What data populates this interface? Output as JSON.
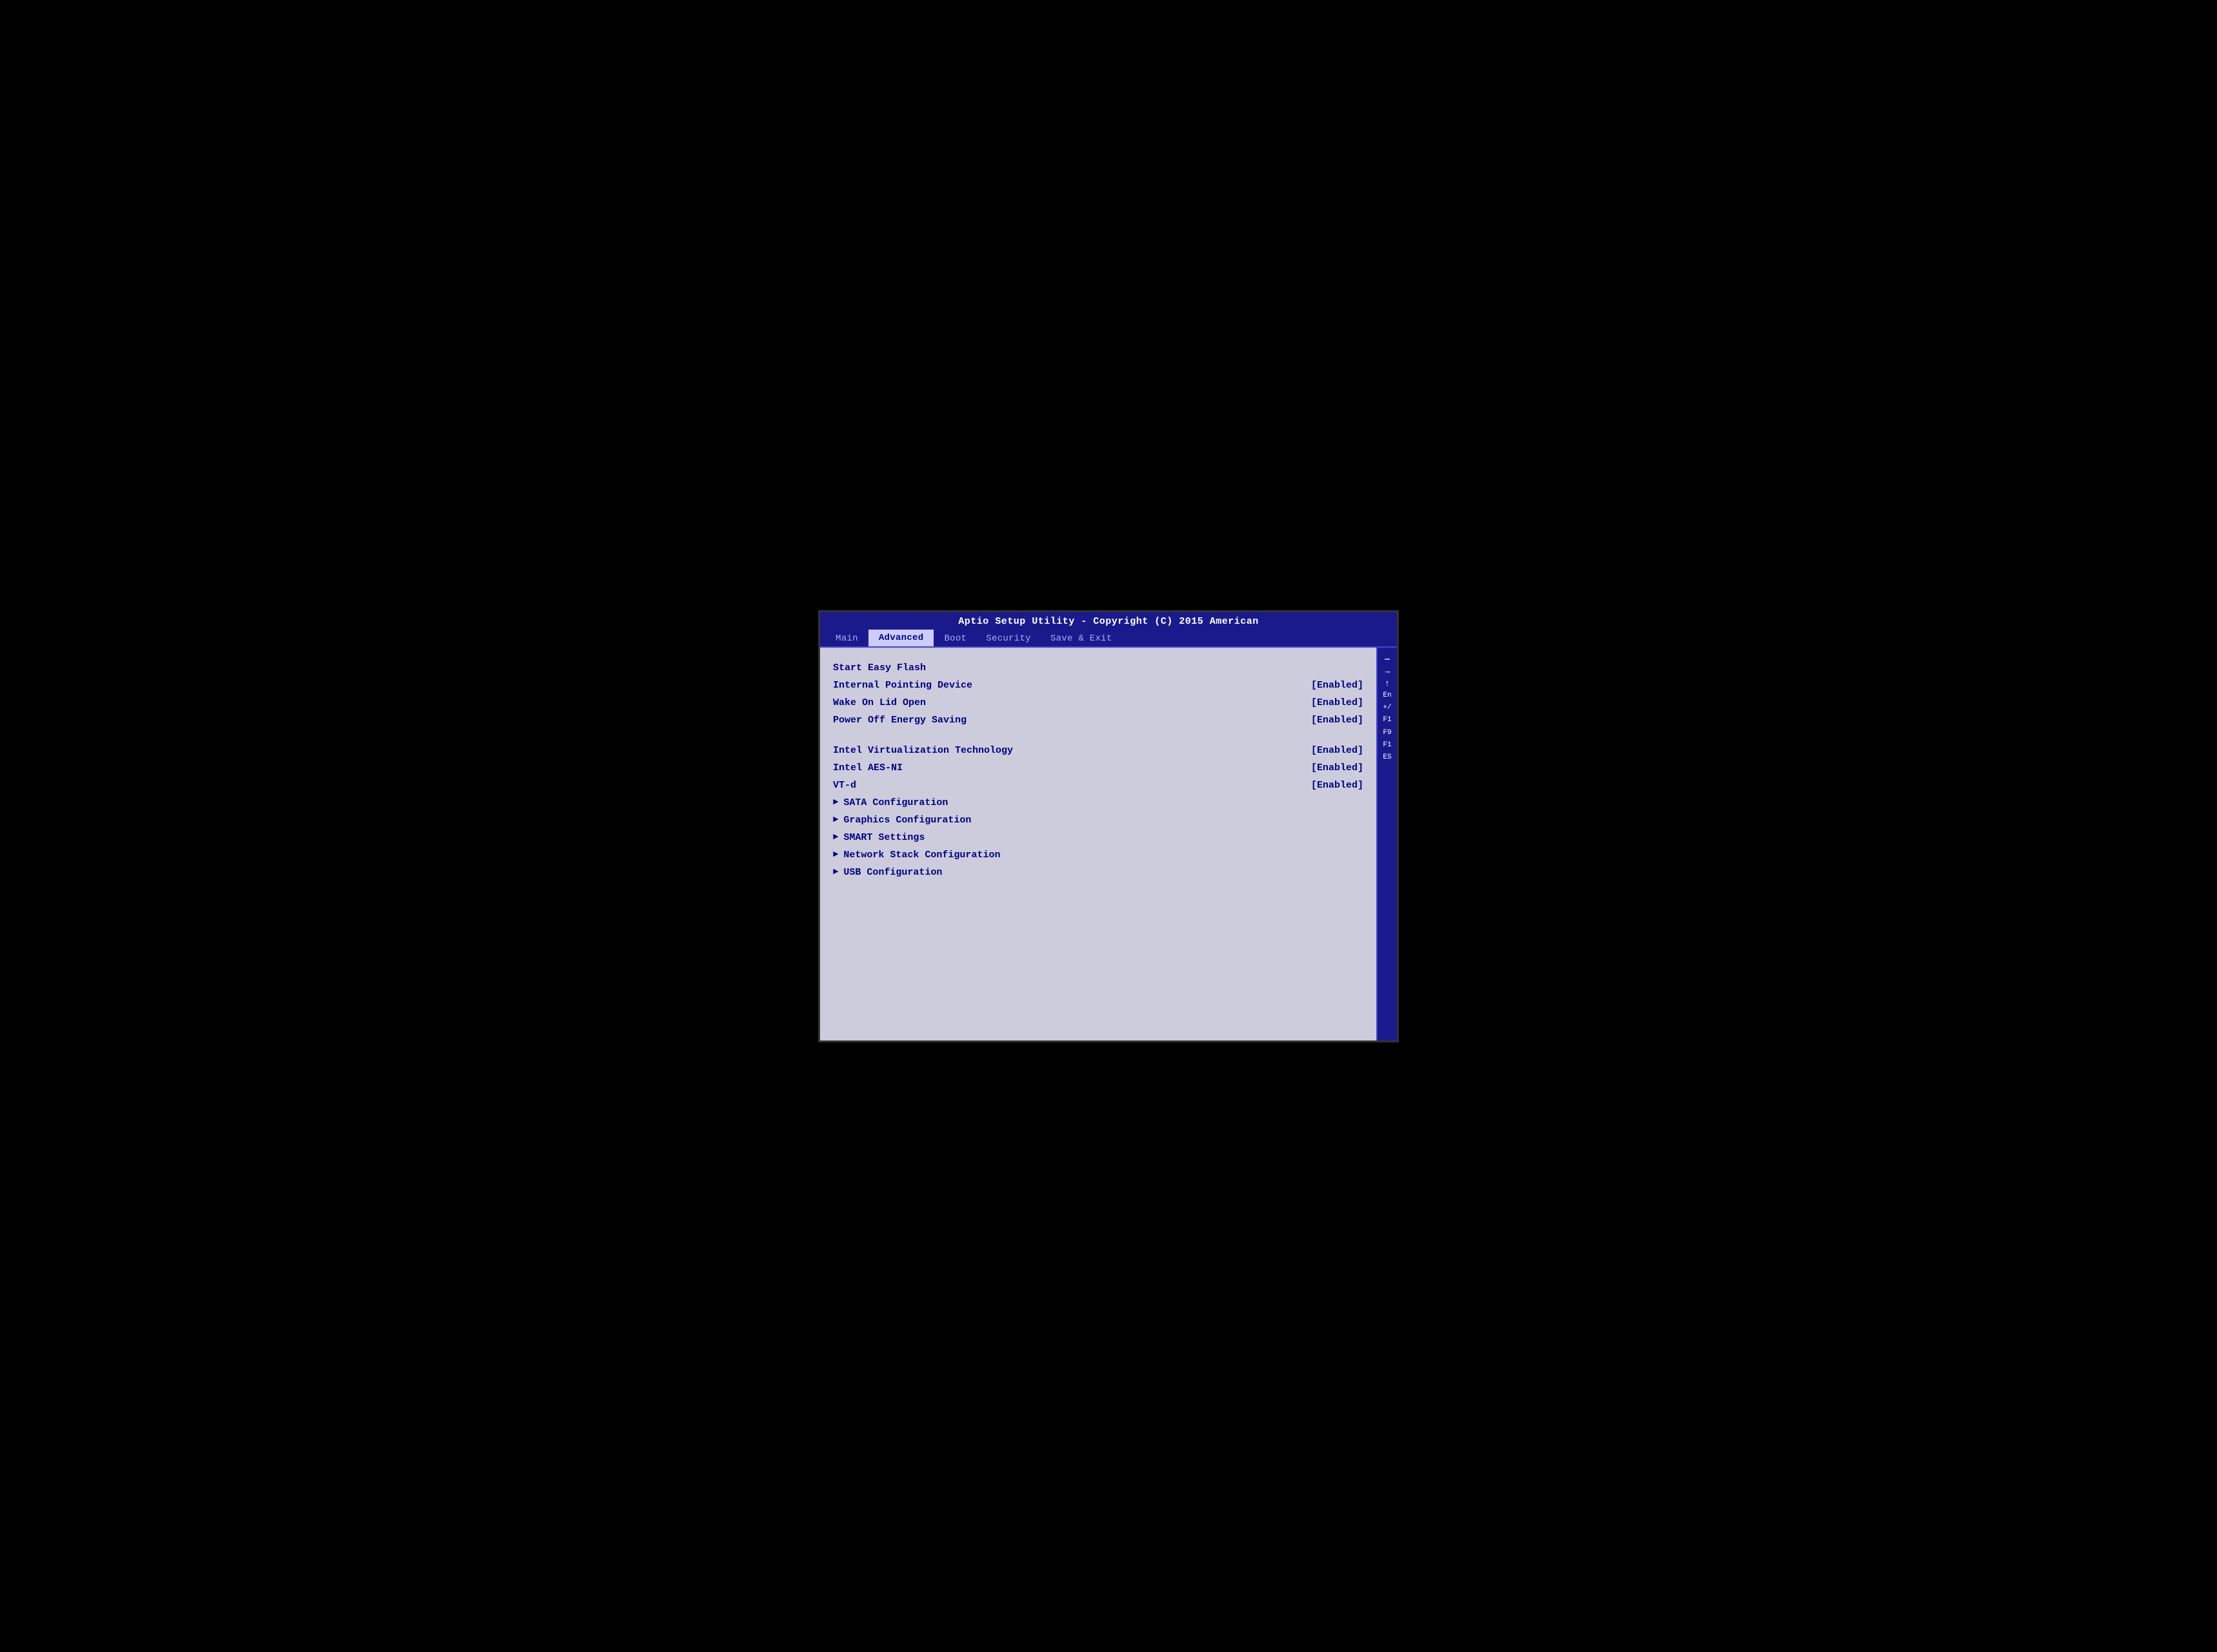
{
  "header": {
    "title": "Aptio Setup Utility - Copyright (C) 2015 American",
    "tabs": [
      {
        "label": "Main",
        "active": false
      },
      {
        "label": "Advanced",
        "active": true
      },
      {
        "label": "Boot",
        "active": false
      },
      {
        "label": "Security",
        "active": false
      },
      {
        "label": "Save & Exit",
        "active": false
      }
    ]
  },
  "menu": {
    "items": [
      {
        "label": "Start Easy Flash",
        "value": "",
        "has_arrow": false,
        "spacer_after": false
      },
      {
        "label": "Internal Pointing Device",
        "value": "[Enabled]",
        "has_arrow": false,
        "spacer_after": false
      },
      {
        "label": "Wake On Lid Open",
        "value": "[Enabled]",
        "has_arrow": false,
        "spacer_after": false
      },
      {
        "label": "Power Off Energy Saving",
        "value": "[Enabled]",
        "has_arrow": false,
        "spacer_after": true
      },
      {
        "label": "Intel Virtualization Technology",
        "value": "[Enabled]",
        "has_arrow": false,
        "spacer_after": false
      },
      {
        "label": "Intel AES-NI",
        "value": "[Enabled]",
        "has_arrow": false,
        "spacer_after": false
      },
      {
        "label": "VT-d",
        "value": "[Enabled]",
        "has_arrow": false,
        "spacer_after": false
      },
      {
        "label": "SATA Configuration",
        "value": "",
        "has_arrow": true,
        "spacer_after": false
      },
      {
        "label": "Graphics Configuration",
        "value": "",
        "has_arrow": true,
        "spacer_after": false
      },
      {
        "label": "SMART Settings",
        "value": "",
        "has_arrow": true,
        "spacer_after": false
      },
      {
        "label": "Network Stack Configuration",
        "value": "",
        "has_arrow": true,
        "spacer_after": false
      },
      {
        "label": "USB Configuration",
        "value": "",
        "has_arrow": true,
        "spacer_after": false
      }
    ]
  },
  "sidebar": {
    "keys": [
      {
        "symbol": "—",
        "label": ""
      },
      {
        "symbol": "→",
        "label": ""
      },
      {
        "symbol": "↑",
        "label": ""
      },
      {
        "symbol": "En",
        "label": ""
      },
      {
        "symbol": "+/",
        "label": ""
      },
      {
        "symbol": "F1",
        "label": ""
      },
      {
        "symbol": "F9",
        "label": ""
      },
      {
        "symbol": "F1",
        "label": ""
      },
      {
        "symbol": "ES",
        "label": ""
      }
    ]
  }
}
